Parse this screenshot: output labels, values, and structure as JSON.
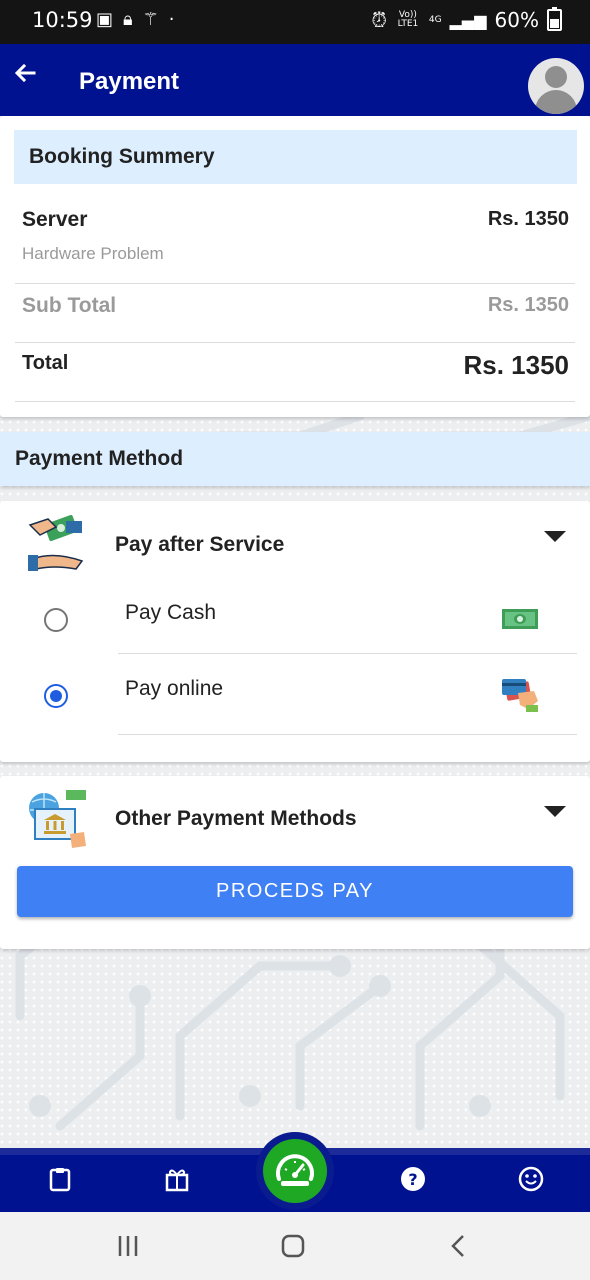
{
  "status_bar": {
    "time": "10:59",
    "network_top": "Vo)) LTE1",
    "network_4g": "4G",
    "battery": "60%"
  },
  "app_bar": {
    "title": "Payment",
    "back_icon": "arrow-left-icon",
    "avatar_icon": "user-avatar-icon"
  },
  "booking_summary": {
    "heading": "Booking Summery",
    "item_name": "Server",
    "item_price": "Rs. 1350",
    "item_desc": "Hardware Problem",
    "subtotal_label": "Sub Total",
    "subtotal_value": "Rs. 1350",
    "total_label": "Total",
    "total_value": "Rs. 1350"
  },
  "payment_method": {
    "heading": "Payment Method",
    "pay_after_service": {
      "title": "Pay after Service",
      "icon": "hand-money-icon",
      "options": [
        {
          "label": "Pay Cash",
          "selected": false,
          "icon": "cash-note-icon"
        },
        {
          "label": "Pay online",
          "selected": true,
          "icon": "credit-card-hand-icon"
        }
      ]
    },
    "other": {
      "title": "Other Payment Methods",
      "icon": "bank-globe-icon"
    },
    "button_label": "PROCEDS PAY"
  },
  "bottom_nav": {
    "items": [
      "clipboard-icon",
      "gift-icon",
      "speedometer-icon",
      "help-icon",
      "smiley-icon"
    ]
  },
  "colors": {
    "app_bar": "#00128f",
    "header_bg": "#ddeeff",
    "button": "#3f80f5",
    "radio_selected": "#1f5de0",
    "fab": "#1ea824"
  }
}
